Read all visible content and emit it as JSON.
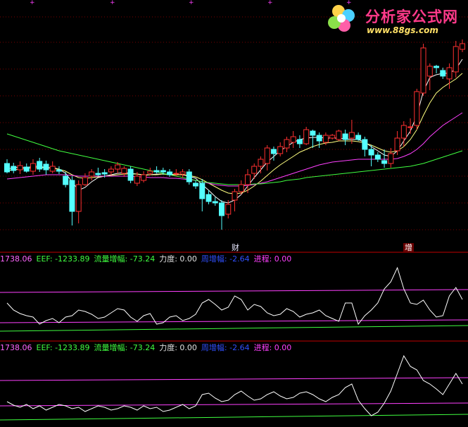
{
  "app": {
    "logo_title": "分析家公式网",
    "logo_url": "www.88gs.com"
  },
  "markers": {
    "cai": "财",
    "zeng": "增"
  },
  "indicator_panel_1": {
    "readouts": [
      {
        "label": "1738.06",
        "color": "#ff66ff"
      },
      {
        "label": "EEF:",
        "value": "-1233.89",
        "color": "#40ff40"
      },
      {
        "label": "流量增幅:",
        "value": "-73.24",
        "color": "#40ff40"
      },
      {
        "label": "力度:",
        "value": "0.00",
        "color": "#e0e0e0"
      },
      {
        "label": "周增幅:",
        "value": "-2.64",
        "color": "#3050ff"
      },
      {
        "label": "进程:",
        "value": "0.00",
        "color": "#ff40ff"
      }
    ]
  },
  "indicator_panel_2": {
    "readouts": [
      {
        "label": "1738.06",
        "color": "#ff66ff"
      },
      {
        "label": "EEF:",
        "value": "-1233.89",
        "color": "#40ff40"
      },
      {
        "label": "流量增幅:",
        "value": "-73.24",
        "color": "#40ff40"
      },
      {
        "label": "力度:",
        "value": "0.00",
        "color": "#e0e0e0"
      },
      {
        "label": "周增幅:",
        "value": "-2.64",
        "color": "#3050ff"
      },
      {
        "label": "进程:",
        "value": "0.00",
        "color": "#ff40ff"
      }
    ]
  },
  "colors": {
    "background": "#000000",
    "up_candle": "#ff3030",
    "down_candle": "#54ffff",
    "grid": "#7a0000",
    "ma_short": "#ffffff",
    "ma_mid": "#ffff80",
    "ma_long": "#ff40ff",
    "ma_xlong": "#40ff40",
    "separator": "#c00000"
  },
  "chart_data": {
    "type": "candlestick",
    "series": [
      {
        "name": "candles",
        "ohlc": [
          [
            232,
            244,
            226,
            246
          ],
          [
            236,
            242,
            231,
            246
          ],
          [
            241,
            235,
            229,
            247
          ],
          [
            237,
            243,
            232,
            245
          ],
          [
            243,
            232,
            226,
            248
          ],
          [
            229,
            240,
            224,
            244
          ],
          [
            233,
            241,
            228,
            248
          ],
          [
            243,
            236,
            229,
            246
          ],
          [
            241,
            243,
            236,
            247
          ],
          [
            250,
            262,
            244,
            266
          ],
          [
            256,
            300,
            250,
            320
          ],
          [
            300,
            262,
            256,
            317
          ],
          [
            262,
            252,
            246,
            264
          ],
          [
            250,
            244,
            240,
            256
          ],
          [
            246,
            248,
            238,
            250
          ],
          [
            245,
            247,
            240,
            252
          ],
          [
            244,
            240,
            236,
            249
          ],
          [
            240,
            234,
            230,
            246
          ],
          [
            246,
            239,
            236,
            251
          ],
          [
            240,
            256,
            236,
            260
          ],
          [
            260,
            250,
            244,
            264
          ],
          [
            256,
            248,
            243,
            259
          ],
          [
            246,
            243,
            238,
            249
          ],
          [
            242,
            244,
            236,
            246
          ],
          [
            242,
            244,
            238,
            248
          ],
          [
            244,
            248,
            240,
            251
          ],
          [
            246,
            246,
            240,
            250
          ],
          [
            247,
            244,
            240,
            252
          ],
          [
            244,
            258,
            240,
            262
          ],
          [
            260,
            264,
            256,
            268
          ],
          [
            260,
            282,
            254,
            300
          ],
          [
            276,
            286,
            270,
            290
          ],
          [
            286,
            288,
            280,
            292
          ],
          [
            288,
            306,
            284,
            326
          ],
          [
            304,
            290,
            284,
            310
          ],
          [
            284,
            272,
            268,
            300
          ],
          [
            272,
            262,
            256,
            276
          ],
          [
            262,
            248,
            240,
            274
          ],
          [
            246,
            236,
            232,
            254
          ],
          [
            236,
            226,
            222,
            246
          ],
          [
            232,
            210,
            206,
            242
          ],
          [
            212,
            218,
            208,
            228
          ],
          [
            218,
            208,
            202,
            222
          ],
          [
            210,
            198,
            194,
            216
          ],
          [
            202,
            194,
            186,
            210
          ],
          [
            198,
            204,
            192,
            210
          ],
          [
            204,
            184,
            180,
            206
          ],
          [
            186,
            192,
            184,
            210
          ],
          [
            192,
            200,
            188,
            210
          ],
          [
            202,
            192,
            188,
            206
          ],
          [
            196,
            192,
            190,
            198
          ],
          [
            198,
            186,
            184,
            200
          ],
          [
            190,
            198,
            184,
            206
          ],
          [
            196,
            188,
            170,
            204
          ],
          [
            192,
            198,
            188,
            200
          ],
          [
            198,
            212,
            194,
            222
          ],
          [
            212,
            220,
            206,
            236
          ],
          [
            220,
            226,
            216,
            230
          ],
          [
            228,
            232,
            212,
            238
          ],
          [
            232,
            218,
            210,
            238
          ],
          [
            214,
            196,
            186,
            220
          ],
          [
            196,
            178,
            172,
            208
          ],
          [
            180,
            180,
            168,
            190
          ],
          [
            178,
            130,
            126,
            184
          ],
          [
            132,
            68,
            62,
            136
          ],
          [
            108,
            94,
            90,
            128
          ],
          [
            94,
            96,
            92,
            104
          ],
          [
            100,
            108,
            96,
            112
          ],
          [
            112,
            96,
            90,
            126
          ],
          [
            102,
            66,
            58,
            110
          ],
          [
            70,
            62,
            56,
            74
          ]
        ]
      },
      {
        "name": "ma_short",
        "values": [
          240,
          238,
          237,
          238,
          236,
          236,
          238,
          238,
          240,
          246,
          258,
          270,
          266,
          258,
          252,
          250,
          248,
          246,
          245,
          246,
          247,
          249,
          248,
          247,
          247,
          247,
          248,
          248,
          250,
          253,
          262,
          270,
          279,
          286,
          288,
          284,
          276,
          264,
          252,
          241,
          230,
          222,
          214,
          208,
          202,
          198,
          196,
          195,
          195,
          196,
          196,
          196,
          197,
          198,
          198,
          202,
          208,
          214,
          220,
          222,
          214,
          200,
          186,
          164,
          130,
          110,
          106,
          104,
          104,
          98,
          84
        ]
      },
      {
        "name": "ma_mid",
        "values": [
          242,
          241,
          240,
          239,
          238,
          238,
          238,
          239,
          240,
          243,
          248,
          252,
          253,
          252,
          251,
          250,
          249,
          248,
          247,
          247,
          247,
          248,
          248,
          248,
          247,
          248,
          248,
          248,
          249,
          251,
          255,
          260,
          265,
          270,
          274,
          275,
          274,
          270,
          264,
          257,
          249,
          241,
          234,
          228,
          222,
          216,
          212,
          208,
          205,
          203,
          202,
          200,
          200,
          200,
          201,
          203,
          206,
          210,
          214,
          216,
          214,
          208,
          198,
          184,
          164,
          146,
          132,
          124,
          118,
          112,
          104
        ]
      },
      {
        "name": "ma_long",
        "values": [
          254,
          253,
          252,
          251,
          250,
          249,
          248,
          248,
          248,
          248,
          249,
          250,
          250,
          250,
          250,
          250,
          250,
          250,
          250,
          250,
          251,
          251,
          252,
          252,
          252,
          253,
          253,
          254,
          255,
          256,
          258,
          260,
          262,
          263,
          264,
          264,
          264,
          263,
          262,
          260,
          258,
          255,
          252,
          249,
          246,
          243,
          240,
          237,
          234,
          232,
          230,
          229,
          228,
          227,
          226,
          226,
          226,
          226,
          226,
          226,
          225,
          222,
          218,
          212,
          204,
          194,
          186,
          178,
          172,
          166,
          160
        ]
      },
      {
        "name": "ma_xlong",
        "values": [
          190,
          193,
          196,
          199,
          202,
          205,
          208,
          211,
          214,
          216,
          218,
          220,
          222,
          224,
          226,
          228,
          230,
          232,
          234,
          236,
          238,
          240,
          242,
          244,
          246,
          248,
          250,
          252,
          254,
          256,
          258,
          259,
          260,
          261,
          262,
          262,
          262,
          262,
          261,
          261,
          260,
          259,
          258,
          256,
          255,
          254,
          252,
          251,
          250,
          249,
          248,
          247,
          246,
          245,
          244,
          243,
          242,
          241,
          240,
          239,
          238,
          237,
          236,
          234,
          232,
          229,
          226,
          223,
          220,
          217,
          214
        ]
      }
    ],
    "indicator_1": {
      "line": [
        430,
        440,
        445,
        448,
        450,
        460,
        455,
        452,
        458,
        450,
        448,
        440,
        442,
        446,
        452,
        450,
        444,
        438,
        440,
        450,
        456,
        448,
        445,
        460,
        458,
        450,
        448,
        455,
        452,
        446,
        430,
        425,
        432,
        440,
        436,
        420,
        425,
        440,
        432,
        435,
        444,
        448,
        446,
        438,
        442,
        450,
        446,
        444,
        440,
        448,
        452,
        456,
        430,
        430,
        460,
        448,
        440,
        430,
        410,
        400,
        380,
        410,
        430,
        432,
        426,
        440,
        450,
        448,
        420,
        408,
        425
      ],
      "level_high": 415,
      "level_mid": 458,
      "level_low": 470
    },
    "indicator_2": {
      "line": [
        570,
        575,
        578,
        574,
        580,
        576,
        582,
        578,
        574,
        576,
        580,
        578,
        584,
        580,
        576,
        578,
        582,
        580,
        576,
        578,
        582,
        576,
        580,
        578,
        584,
        582,
        578,
        574,
        580,
        576,
        560,
        558,
        565,
        570,
        568,
        560,
        555,
        562,
        568,
        566,
        560,
        556,
        562,
        566,
        564,
        558,
        556,
        560,
        566,
        570,
        564,
        560,
        550,
        545,
        568,
        580,
        590,
        585,
        572,
        555,
        530,
        505,
        520,
        525,
        540,
        545,
        552,
        560,
        545,
        530,
        545
      ],
      "level_high": 540,
      "level_mid": 576,
      "level_low": 596
    }
  }
}
